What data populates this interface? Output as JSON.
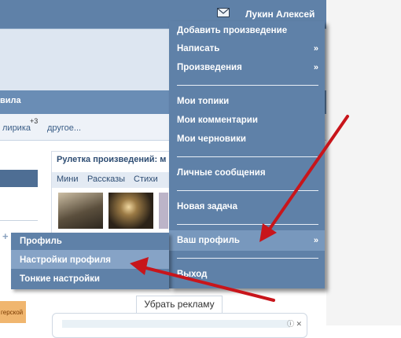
{
  "header": {
    "username": "Лукин Алексей",
    "mail_icon": "envelope-icon"
  },
  "page": {
    "rules_fragment": "вила",
    "tabs": [
      {
        "label": "лирика"
      },
      {
        "label": "другое..."
      }
    ],
    "lyric_count": "+3"
  },
  "roulette": {
    "title": "Рулетка произведений: м",
    "tabs": [
      "Мини",
      "Рассказы",
      "Стихи"
    ]
  },
  "ads": {
    "remove_label": "Убрать рекламу",
    "orange_text": "герской"
  },
  "menu": {
    "items": [
      {
        "label": "Добавить произведение",
        "has_submenu": false
      },
      {
        "label": "Написать",
        "has_submenu": true
      },
      {
        "label": "Произведения",
        "has_submenu": true
      },
      {
        "label": "Мои топики",
        "has_submenu": false
      },
      {
        "label": "Мои комментарии",
        "has_submenu": false
      },
      {
        "label": "Мои черновики",
        "has_submenu": false
      },
      {
        "label": "Личные сообщения",
        "has_submenu": false
      },
      {
        "label": "Новая задача",
        "has_submenu": false
      },
      {
        "label": "Ваш профиль",
        "has_submenu": true
      },
      {
        "label": "Выход",
        "has_submenu": false
      }
    ],
    "arrow_glyph": "»"
  },
  "submenu": {
    "items": [
      {
        "label": "Профиль"
      },
      {
        "label": "Настройки профиля"
      },
      {
        "label": "Тонкие настройки"
      }
    ]
  },
  "colors": {
    "menu_bg": "#5f81a8",
    "highlight": "#86a3c6",
    "annotation_arrow": "#c8151b"
  }
}
